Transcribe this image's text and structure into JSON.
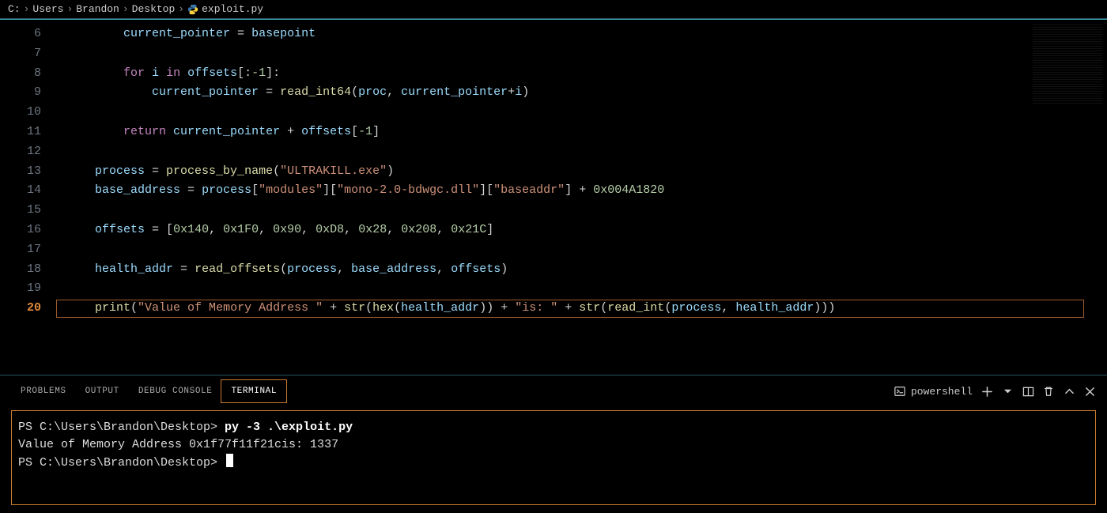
{
  "breadcrumb": {
    "segments": [
      "C:",
      "Users",
      "Brandon",
      "Desktop"
    ],
    "file": "exploit.py",
    "icon": "python-icon"
  },
  "editor": {
    "first_line_no": 6,
    "current_line_no": 20,
    "lines": [
      {
        "n": 6,
        "indent": 8,
        "tokens": [
          [
            "var",
            "current_pointer"
          ],
          [
            "op",
            " = "
          ],
          [
            "var",
            "basepoint"
          ]
        ]
      },
      {
        "n": 7,
        "indent": 0,
        "tokens": []
      },
      {
        "n": 8,
        "indent": 8,
        "tokens": [
          [
            "kw",
            "for"
          ],
          [
            "op",
            " "
          ],
          [
            "var",
            "i"
          ],
          [
            "op",
            " "
          ],
          [
            "kw",
            "in"
          ],
          [
            "op",
            " "
          ],
          [
            "var",
            "offsets"
          ],
          [
            "pun",
            "[:"
          ],
          [
            "num",
            "-1"
          ],
          [
            "pun",
            "]:"
          ]
        ]
      },
      {
        "n": 9,
        "indent": 12,
        "tokens": [
          [
            "var",
            "current_pointer"
          ],
          [
            "op",
            " = "
          ],
          [
            "fn",
            "read_int64"
          ],
          [
            "pun",
            "("
          ],
          [
            "var",
            "proc"
          ],
          [
            "pun",
            ", "
          ],
          [
            "var",
            "current_pointer"
          ],
          [
            "op",
            "+"
          ],
          [
            "var",
            "i"
          ],
          [
            "pun",
            ")"
          ]
        ]
      },
      {
        "n": 10,
        "indent": 0,
        "tokens": []
      },
      {
        "n": 11,
        "indent": 8,
        "tokens": [
          [
            "kw",
            "return"
          ],
          [
            "op",
            " "
          ],
          [
            "var",
            "current_pointer"
          ],
          [
            "op",
            " + "
          ],
          [
            "var",
            "offsets"
          ],
          [
            "pun",
            "["
          ],
          [
            "num",
            "-1"
          ],
          [
            "pun",
            "]"
          ]
        ]
      },
      {
        "n": 12,
        "indent": 0,
        "tokens": []
      },
      {
        "n": 13,
        "indent": 4,
        "tokens": [
          [
            "var",
            "process"
          ],
          [
            "op",
            " = "
          ],
          [
            "fn",
            "process_by_name"
          ],
          [
            "pun",
            "("
          ],
          [
            "str",
            "\"ULTRAKILL.exe\""
          ],
          [
            "pun",
            ")"
          ]
        ]
      },
      {
        "n": 14,
        "indent": 4,
        "tokens": [
          [
            "var",
            "base_address"
          ],
          [
            "op",
            " = "
          ],
          [
            "var",
            "process"
          ],
          [
            "pun",
            "["
          ],
          [
            "str",
            "\"modules\""
          ],
          [
            "pun",
            "]["
          ],
          [
            "str",
            "\"mono-2.0-bdwgc.dll\""
          ],
          [
            "pun",
            "]["
          ],
          [
            "str",
            "\"baseaddr\""
          ],
          [
            "pun",
            "]"
          ],
          [
            "op",
            " + "
          ],
          [
            "num",
            "0x004A1820"
          ]
        ]
      },
      {
        "n": 15,
        "indent": 0,
        "tokens": []
      },
      {
        "n": 16,
        "indent": 4,
        "tokens": [
          [
            "var",
            "offsets"
          ],
          [
            "op",
            " = "
          ],
          [
            "pun",
            "["
          ],
          [
            "num",
            "0x140"
          ],
          [
            "pun",
            ", "
          ],
          [
            "num",
            "0x1F0"
          ],
          [
            "pun",
            ", "
          ],
          [
            "num",
            "0x90"
          ],
          [
            "pun",
            ", "
          ],
          [
            "num",
            "0xD8"
          ],
          [
            "pun",
            ", "
          ],
          [
            "num",
            "0x28"
          ],
          [
            "pun",
            ", "
          ],
          [
            "num",
            "0x208"
          ],
          [
            "pun",
            ", "
          ],
          [
            "num",
            "0x21C"
          ],
          [
            "pun",
            "]"
          ]
        ]
      },
      {
        "n": 17,
        "indent": 0,
        "tokens": []
      },
      {
        "n": 18,
        "indent": 4,
        "tokens": [
          [
            "var",
            "health_addr"
          ],
          [
            "op",
            " = "
          ],
          [
            "fn",
            "read_offsets"
          ],
          [
            "pun",
            "("
          ],
          [
            "var",
            "process"
          ],
          [
            "pun",
            ", "
          ],
          [
            "var",
            "base_address"
          ],
          [
            "pun",
            ", "
          ],
          [
            "var",
            "offsets"
          ],
          [
            "pun",
            ")"
          ]
        ]
      },
      {
        "n": 19,
        "indent": 0,
        "tokens": []
      },
      {
        "n": 20,
        "indent": 4,
        "tokens": [
          [
            "fn",
            "print"
          ],
          [
            "pun",
            "("
          ],
          [
            "str",
            "\"Value of Memory Address \""
          ],
          [
            "op",
            " + "
          ],
          [
            "fn",
            "str"
          ],
          [
            "pun",
            "("
          ],
          [
            "fn",
            "hex"
          ],
          [
            "pun",
            "("
          ],
          [
            "var",
            "health_addr"
          ],
          [
            "pun",
            "))"
          ],
          [
            "op",
            " + "
          ],
          [
            "str",
            "\"is: \""
          ],
          [
            "op",
            " + "
          ],
          [
            "fn",
            "str"
          ],
          [
            "pun",
            "("
          ],
          [
            "fn",
            "read_int"
          ],
          [
            "pun",
            "("
          ],
          [
            "var",
            "process"
          ],
          [
            "pun",
            ", "
          ],
          [
            "var",
            "health_addr"
          ],
          [
            "pun",
            ")))"
          ]
        ]
      }
    ]
  },
  "panel": {
    "tabs": [
      "PROBLEMS",
      "OUTPUT",
      "DEBUG CONSOLE",
      "TERMINAL"
    ],
    "active_tab": 3,
    "shell": "powershell",
    "terminal_lines": [
      {
        "type": "prompt",
        "prompt": "PS C:\\Users\\Brandon\\Desktop> ",
        "cmd": "py -3 .\\exploit.py"
      },
      {
        "type": "output",
        "text": "Value of Memory Address 0x1f77f11f21cis: 1337"
      },
      {
        "type": "prompt",
        "prompt": "PS C:\\Users\\Brandon\\Desktop> ",
        "cmd": ""
      }
    ]
  }
}
